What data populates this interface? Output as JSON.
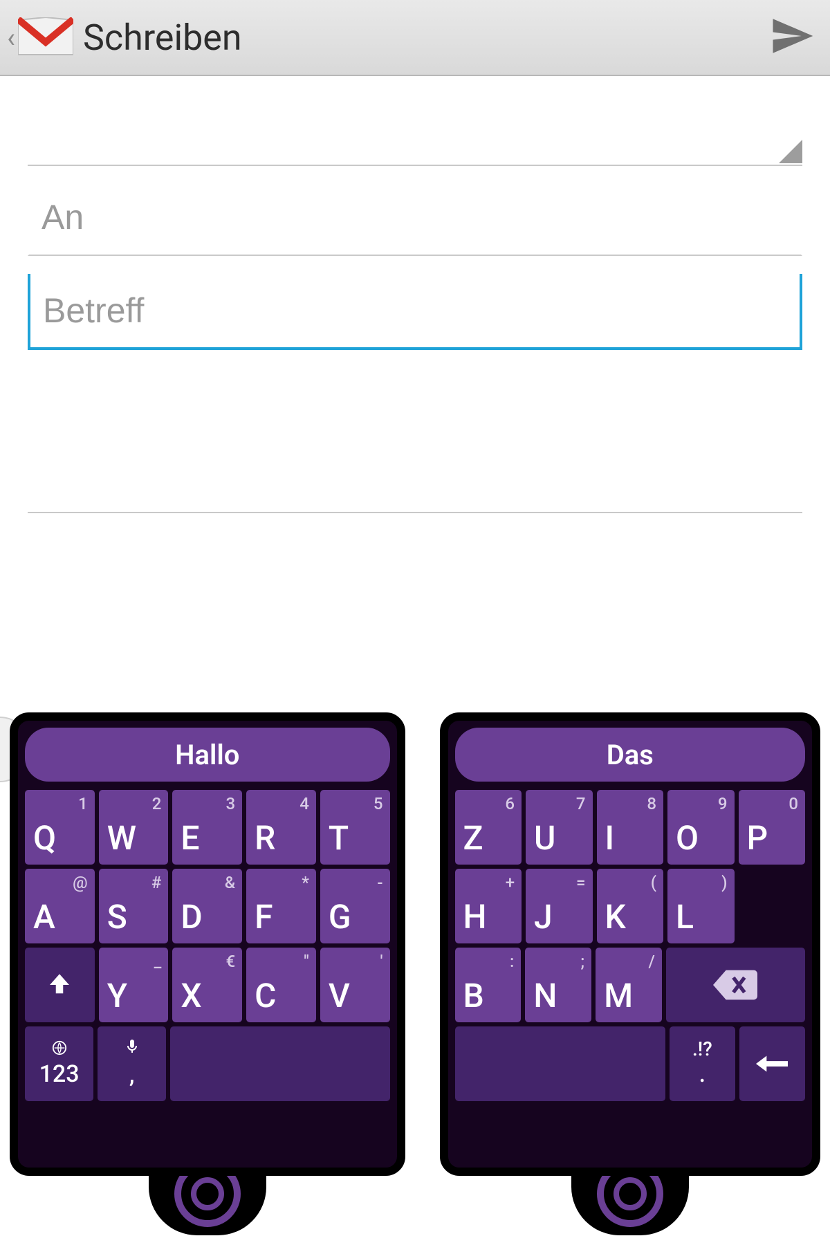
{
  "header": {
    "title": "Schreiben"
  },
  "compose": {
    "to_placeholder": "An",
    "subject_placeholder": "Betreff"
  },
  "keyboard": {
    "suggestion_left": "Hallo",
    "suggestion_right": "Das",
    "left": {
      "row1": [
        {
          "main": "Q",
          "sec": "1"
        },
        {
          "main": "W",
          "sec": "2"
        },
        {
          "main": "E",
          "sec": "3"
        },
        {
          "main": "R",
          "sec": "4"
        },
        {
          "main": "T",
          "sec": "5"
        }
      ],
      "row2": [
        {
          "main": "A",
          "sec": "@"
        },
        {
          "main": "S",
          "sec": "#"
        },
        {
          "main": "D",
          "sec": "&"
        },
        {
          "main": "F",
          "sec": "*"
        },
        {
          "main": "G",
          "sec": "-"
        }
      ],
      "row3": [
        {
          "main": "shift"
        },
        {
          "main": "Y",
          "sec": "_"
        },
        {
          "main": "X",
          "sec": "€"
        },
        {
          "main": "C",
          "sec": "\""
        },
        {
          "main": "V",
          "sec": "'"
        }
      ],
      "bottom": {
        "mode": "123",
        "mic": "mic",
        "comma": ","
      }
    },
    "right": {
      "row1": [
        {
          "main": "Z",
          "sec": "6"
        },
        {
          "main": "U",
          "sec": "7"
        },
        {
          "main": "I",
          "sec": "8"
        },
        {
          "main": "O",
          "sec": "9"
        },
        {
          "main": "P",
          "sec": "0"
        }
      ],
      "row2": [
        {
          "main": "H",
          "sec": "+"
        },
        {
          "main": "J",
          "sec": "="
        },
        {
          "main": "K",
          "sec": "("
        },
        {
          "main": "L",
          "sec": ")"
        }
      ],
      "row3": [
        {
          "main": "B",
          "sec": ":"
        },
        {
          "main": "N",
          "sec": ";"
        },
        {
          "main": "M",
          "sec": "/"
        },
        {
          "main": "backspace"
        }
      ],
      "bottom": {
        "period": ".",
        "punct": ".!?",
        "enter": "enter"
      }
    }
  }
}
